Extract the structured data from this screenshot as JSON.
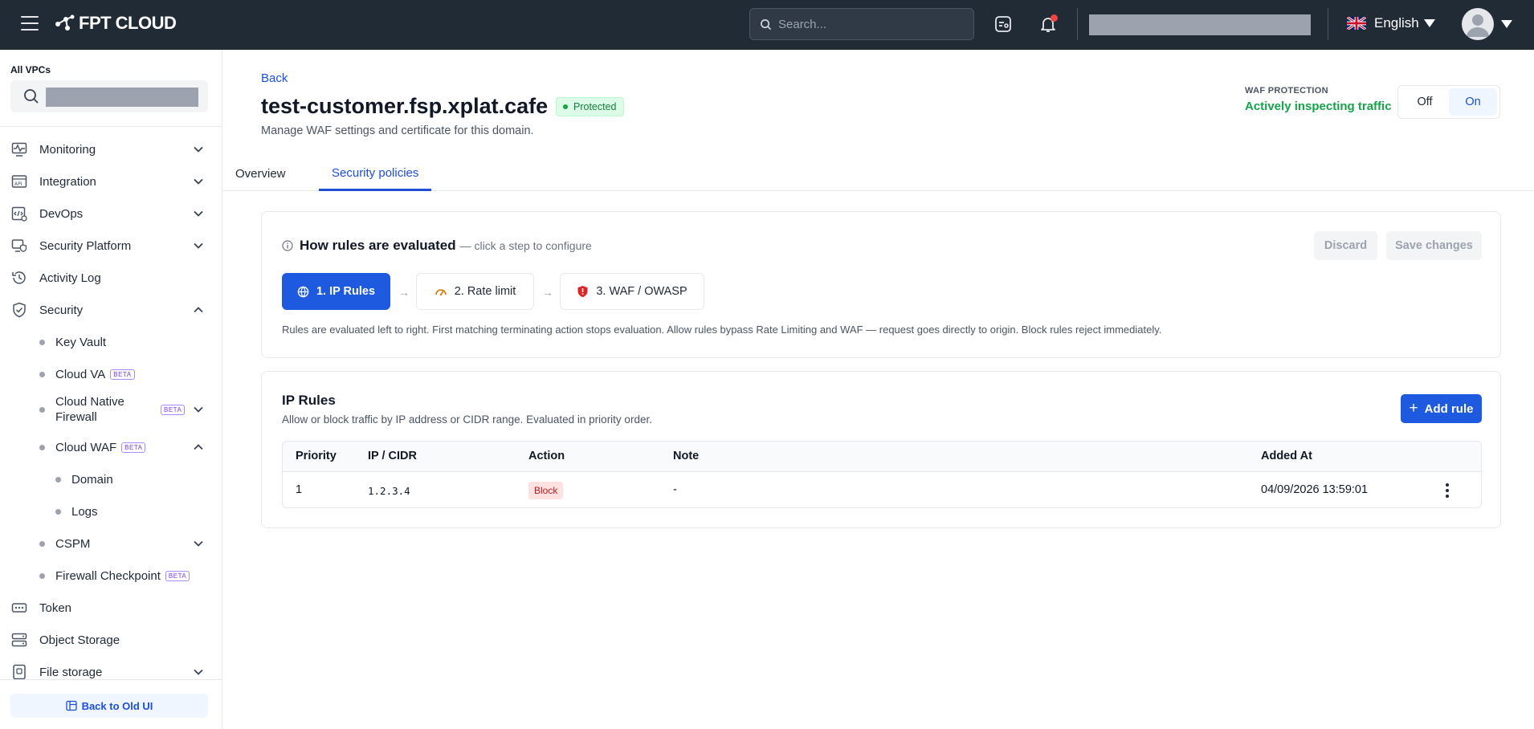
{
  "topbar": {
    "logo_text": "FPT CLOUD",
    "search_placeholder": "Search...",
    "language": "English"
  },
  "sidebar": {
    "vpc_label": "All VPCs",
    "items": [
      {
        "label": "Monitoring",
        "icon": "monitoring-icon",
        "expanded": false
      },
      {
        "label": "Integration",
        "icon": "api-icon",
        "expanded": false
      },
      {
        "label": "DevOps",
        "icon": "devops-icon",
        "expanded": false
      },
      {
        "label": "Security Platform",
        "icon": "security-platform-icon",
        "expanded": false
      },
      {
        "label": "Activity Log",
        "icon": "activity-log-icon"
      },
      {
        "label": "Security",
        "icon": "shield-icon",
        "expanded": true
      },
      {
        "label": "Token",
        "icon": "token-icon"
      },
      {
        "label": "Object Storage",
        "icon": "object-storage-icon"
      },
      {
        "label": "File storage",
        "icon": "file-storage-icon",
        "expanded": false
      }
    ],
    "security_children": [
      {
        "label": "Key Vault"
      },
      {
        "label": "Cloud VA",
        "beta": "BETA"
      },
      {
        "label": "Cloud Native Firewall",
        "beta": "BETA"
      },
      {
        "label": "Cloud WAF",
        "beta": "BETA"
      },
      {
        "label": "CSPM"
      },
      {
        "label": "Firewall Checkpoint",
        "beta": "BETA"
      }
    ],
    "waf_children": [
      {
        "label": "Domain"
      },
      {
        "label": "Logs"
      }
    ],
    "back_old_ui": "Back to Old UI"
  },
  "header": {
    "back": "Back",
    "domain": "test-customer.fsp.xplat.cafe",
    "status_badge": "Protected",
    "subtitle": "Manage WAF settings and certificate for this domain.",
    "waf_protection_label": "WAF PROTECTION",
    "waf_protection_status": "Actively inspecting traffic",
    "toggle_off": "Off",
    "toggle_on": "On",
    "toggle_selected": "On"
  },
  "tabs": [
    {
      "label": "Overview",
      "active": false
    },
    {
      "label": "Security policies",
      "active": true
    }
  ],
  "evaluation": {
    "title": "How rules are evaluated",
    "hint": "— click a step to configure",
    "discard": "Discard",
    "save": "Save changes",
    "steps": [
      {
        "label": "1. IP Rules",
        "icon": "globe-icon",
        "active": true
      },
      {
        "label": "2. Rate limit",
        "icon": "speedometer-icon",
        "active": false
      },
      {
        "label": "3. WAF / OWASP",
        "icon": "shield-alert-icon",
        "active": false
      }
    ],
    "arrow": "→",
    "note": "Rules are evaluated left to right. First matching terminating action stops evaluation. Allow rules bypass Rate Limiting and WAF — request goes directly to origin. Block rules reject immediately."
  },
  "ip_rules": {
    "title": "IP Rules",
    "subtitle": "Allow or block traffic by IP address or CIDR range. Evaluated in priority order.",
    "add_button": "Add rule",
    "columns": [
      "Priority",
      "IP / CIDR",
      "Action",
      "Note",
      "Added At"
    ],
    "rows": [
      {
        "priority": "1",
        "ip": "1.2.3.4",
        "action": "Block",
        "note": "-",
        "added_at": "04/09/2026 13:59:01"
      }
    ]
  },
  "colors": {
    "topbar_bg": "#212b36",
    "accent": "#1d5ae0",
    "success": "#16a34a",
    "danger": "#b91c1c"
  }
}
